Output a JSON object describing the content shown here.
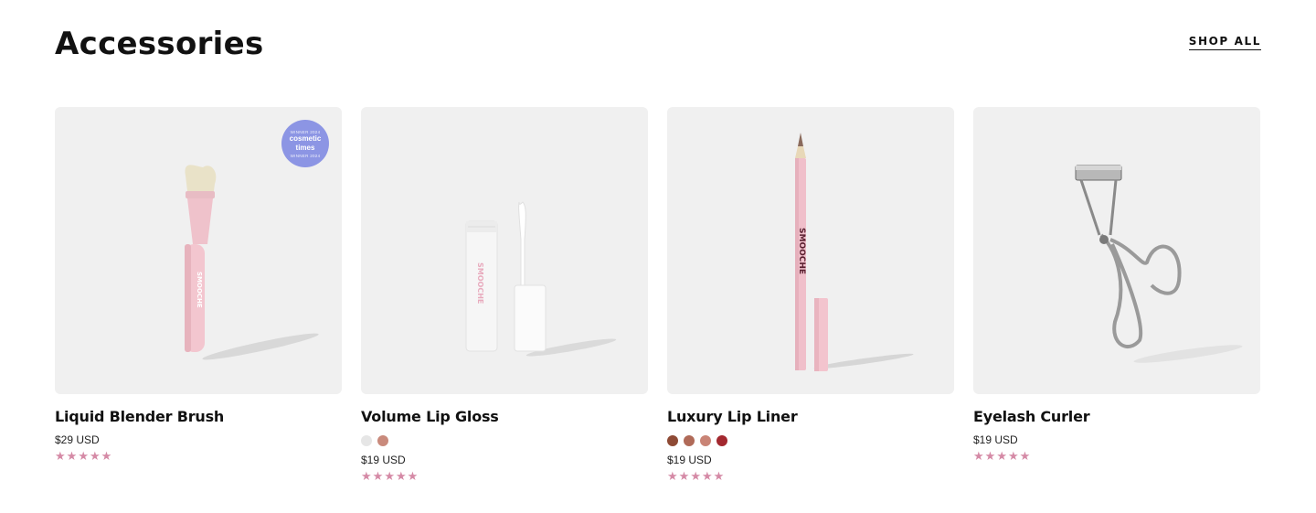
{
  "section": {
    "title": "Accessories",
    "shop_all_label": "SHOP ALL"
  },
  "colors": {
    "star": "#d58aa6",
    "tile_bg": "#f0f0f0",
    "badge_bg": "#8c95e4"
  },
  "products": [
    {
      "name": "Liquid Blender Brush",
      "price": "$29 USD",
      "rating": 4.5,
      "image_icon": "makeup-brush",
      "badge": {
        "top": "WINNER 2024",
        "line1": "cosmetic",
        "line2": "times",
        "bottom": "WINNER 2024"
      },
      "product_text": "SMOOCHE",
      "swatches": []
    },
    {
      "name": "Volume Lip Gloss",
      "price": "$19 USD",
      "rating": 4.5,
      "image_icon": "lip-gloss",
      "product_text": "SMOOCHE",
      "swatches": [
        "#e6e6e6",
        "#c98a7c"
      ]
    },
    {
      "name": "Luxury Lip Liner",
      "price": "$19 USD",
      "rating": 4.5,
      "image_icon": "lip-liner-pencil",
      "product_text": "SMOOCHE",
      "swatches": [
        "#8e4a35",
        "#b06a58",
        "#c98476",
        "#a3282f"
      ]
    },
    {
      "name": "Eyelash Curler",
      "price": "$19 USD",
      "rating": 5,
      "image_icon": "eyelash-curler",
      "swatches": []
    }
  ]
}
